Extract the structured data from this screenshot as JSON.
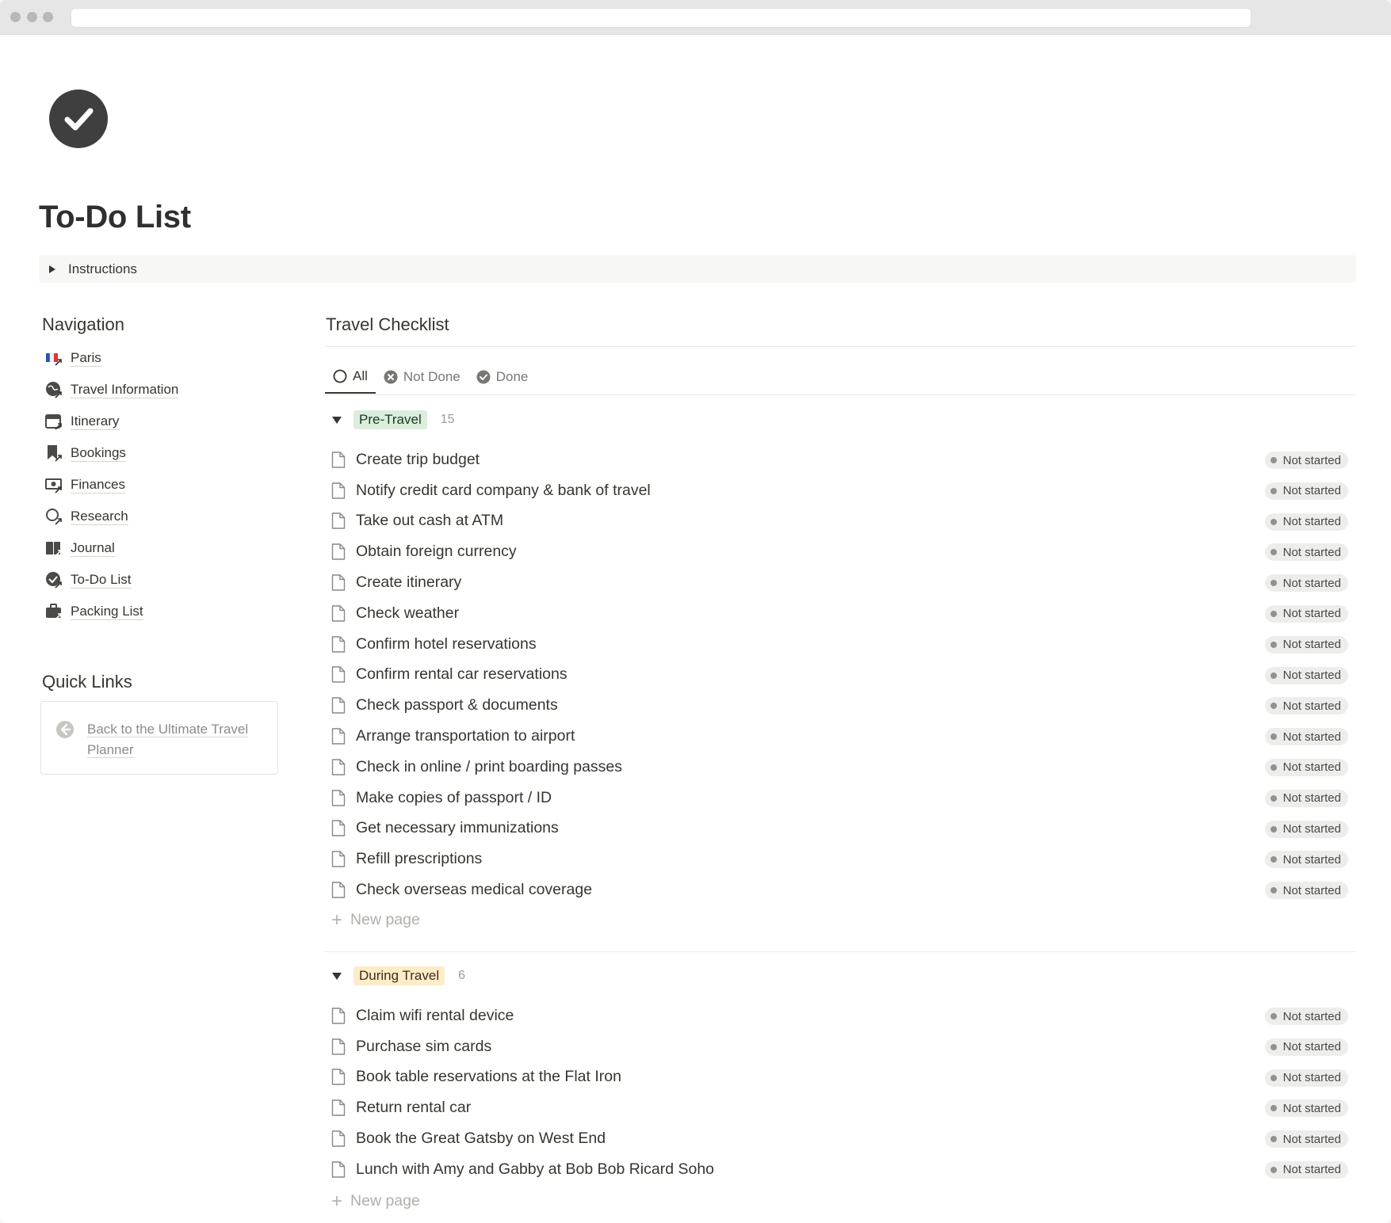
{
  "page": {
    "title": "To-Do List",
    "icon": "check-circle-icon"
  },
  "instructions": {
    "label": "Instructions"
  },
  "navigation": {
    "heading": "Navigation",
    "items": [
      {
        "label": "Paris",
        "icon": "france-flag-icon"
      },
      {
        "label": "Travel Information",
        "icon": "globe-icon"
      },
      {
        "label": "Itinerary",
        "icon": "calendar-icon"
      },
      {
        "label": "Bookings",
        "icon": "bookmark-icon"
      },
      {
        "label": "Finances",
        "icon": "money-icon"
      },
      {
        "label": "Research",
        "icon": "magnifier-icon"
      },
      {
        "label": "Journal",
        "icon": "book-icon"
      },
      {
        "label": "To-Do List",
        "icon": "check-circle-icon"
      },
      {
        "label": "Packing List",
        "icon": "briefcase-icon"
      }
    ]
  },
  "quick_links": {
    "heading": "Quick Links",
    "items": [
      {
        "label": "Back to the Ultimate Travel Planner",
        "icon": "arrow-left-circle-icon"
      }
    ]
  },
  "database": {
    "title": "Travel Checklist",
    "tabs": [
      {
        "label": "All",
        "icon": "circle-outline-icon",
        "active": true
      },
      {
        "label": "Not Done",
        "icon": "x-circle-icon",
        "active": false
      },
      {
        "label": "Done",
        "icon": "check-circle-icon",
        "active": false
      }
    ],
    "new_page_label": "New page",
    "groups": [
      {
        "name": "Pre-Travel",
        "count": "15",
        "tag_bg": "#dbeddb",
        "tag_color": "#1c3829",
        "items": [
          {
            "title": "Create trip budget",
            "status": "Not started"
          },
          {
            "title": "Notify credit card company & bank of travel",
            "status": "Not started"
          },
          {
            "title": "Take out cash at ATM",
            "status": "Not started"
          },
          {
            "title": "Obtain foreign currency",
            "status": "Not started"
          },
          {
            "title": "Create itinerary",
            "status": "Not started"
          },
          {
            "title": "Check weather",
            "status": "Not started"
          },
          {
            "title": "Confirm hotel reservations",
            "status": "Not started"
          },
          {
            "title": "Confirm rental car reservations",
            "status": "Not started"
          },
          {
            "title": "Check passport & documents",
            "status": "Not started"
          },
          {
            "title": "Arrange transportation to airport",
            "status": "Not started"
          },
          {
            "title": "Check in online / print boarding passes",
            "status": "Not started"
          },
          {
            "title": "Make copies of passport / ID",
            "status": "Not started"
          },
          {
            "title": "Get necessary immunizations",
            "status": "Not started"
          },
          {
            "title": "Refill prescriptions",
            "status": "Not started"
          },
          {
            "title": "Check overseas medical coverage",
            "status": "Not started"
          }
        ]
      },
      {
        "name": "During Travel",
        "count": "6",
        "tag_bg": "#fdecc8",
        "tag_color": "#402c1b",
        "items": [
          {
            "title": "Claim wifi rental device",
            "status": "Not started"
          },
          {
            "title": "Purchase sim cards",
            "status": "Not started"
          },
          {
            "title": "Book table reservations at the Flat Iron",
            "status": "Not started"
          },
          {
            "title": "Return rental car",
            "status": "Not started"
          },
          {
            "title": "Book the Great Gatsby on West End",
            "status": "Not started"
          },
          {
            "title": "Lunch with Amy and Gabby at Bob Bob Ricard Soho",
            "status": "Not started"
          }
        ]
      }
    ]
  }
}
